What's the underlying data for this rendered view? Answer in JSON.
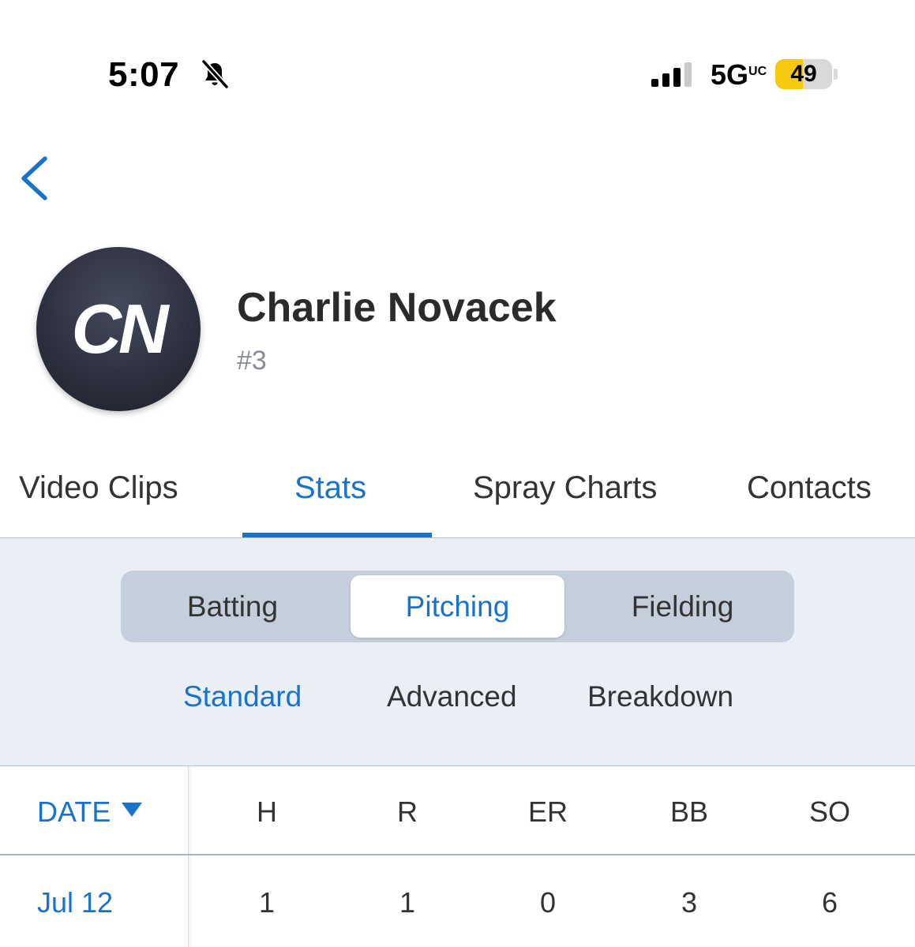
{
  "status_bar": {
    "time": "5:07",
    "network": "5G",
    "network_suffix": "UC",
    "battery": "49",
    "battery_level": 0.49,
    "icons": [
      "bell-slash-icon",
      "signal-bars-icon",
      "battery-icon"
    ]
  },
  "nav": {
    "back_icon": "chevron-left-icon"
  },
  "player": {
    "initials": "CN",
    "name": "Charlie Novacek",
    "number": "#3"
  },
  "tabs": [
    {
      "label": "Video Clips",
      "active": false
    },
    {
      "label": "Stats",
      "active": true
    },
    {
      "label": "Spray Charts",
      "active": false
    },
    {
      "label": "Contacts",
      "active": false
    }
  ],
  "stat_types": [
    {
      "label": "Batting",
      "active": false
    },
    {
      "label": "Pitching",
      "active": true
    },
    {
      "label": "Fielding",
      "active": false
    }
  ],
  "views": [
    {
      "label": "Standard",
      "active": true
    },
    {
      "label": "Advanced",
      "active": false
    },
    {
      "label": "Breakdown",
      "active": false
    }
  ],
  "table": {
    "columns": [
      "DATE",
      "H",
      "R",
      "ER",
      "BB",
      "SO"
    ],
    "sort_icon": "triangle-down-icon",
    "rows": [
      {
        "date": "Jul 12",
        "values": [
          "1",
          "1",
          "0",
          "3",
          "6"
        ]
      }
    ]
  },
  "colors": {
    "accent": "#1a73c9",
    "panel_bg": "#eaeef5",
    "segment_bg": "#c5cfdb",
    "battery_yellow": "#f6c90e"
  }
}
